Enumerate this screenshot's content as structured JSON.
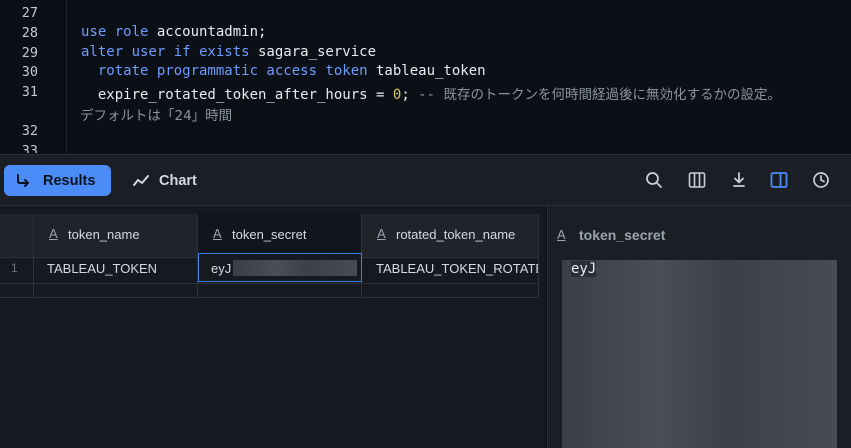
{
  "editor": {
    "lines": [
      {
        "num": "27"
      },
      {
        "num": "28",
        "kw1": "use role",
        "rest1": " accountadmin;"
      },
      {
        "num": "29",
        "kw1": "alter user if exists",
        "rest1": " sagara_service"
      },
      {
        "num": "30",
        "kw1": "  rotate programmatic access token",
        "rest1": " tableau_token"
      },
      {
        "num": "31",
        "rest1": "  expire_rotated_token_after_hours = ",
        "numval": "0",
        "semi": ";",
        "comment": " -- ",
        "comment_jp": "既存のトークンを何時間経過後に無効化するかの設定。"
      },
      {
        "wrap": "デフォルトは「24」時間"
      },
      {
        "num": "32"
      },
      {
        "num": "33"
      }
    ]
  },
  "toolbar": {
    "results_label": "Results",
    "chart_label": "Chart",
    "icons": [
      "search-icon",
      "columns-icon",
      "download-icon",
      "side-panel-icon",
      "history-icon"
    ]
  },
  "grid": {
    "type_glyph": "A",
    "columns": [
      "token_name",
      "token_secret",
      "rotated_token_name"
    ],
    "rows": [
      {
        "index": "1",
        "cells": [
          "TABLEAU_TOKEN",
          "eyJ",
          "TABLEAU_TOKEN_ROTATED"
        ]
      }
    ]
  },
  "detail": {
    "type_glyph": "A",
    "title": "token_secret",
    "value": "eyJ"
  },
  "colors": {
    "accent": "#4c8cf7",
    "keyword": "#6f9cff",
    "number": "#d8c46a"
  }
}
